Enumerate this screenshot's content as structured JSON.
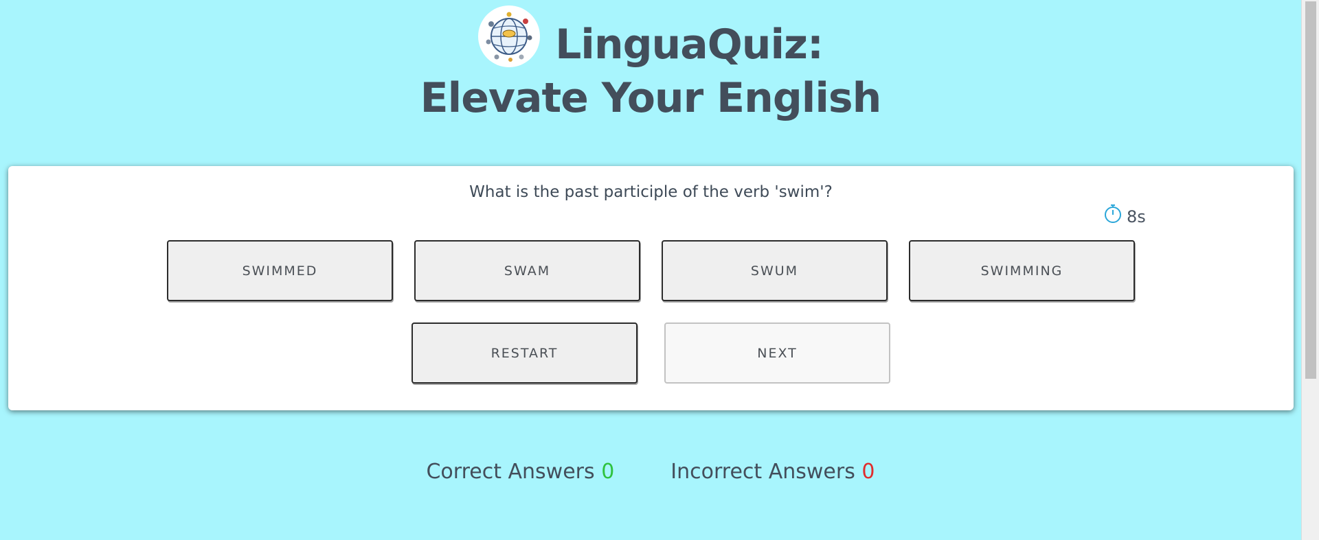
{
  "header": {
    "title_line1": "LinguaQuiz:",
    "title_line2": "Elevate Your English"
  },
  "quiz": {
    "question": "What is the past participle of the verb 'swim'?",
    "timer": "8s",
    "options": [
      "SWIMMED",
      "SWAM",
      "SWUM",
      "SWIMMING"
    ],
    "restart_label": "RESTART",
    "next_label": "NEXT"
  },
  "score": {
    "correct_label": "Correct Answers",
    "correct_value": "0",
    "incorrect_label": "Incorrect Answers",
    "incorrect_value": "0"
  },
  "colors": {
    "background": "#a8f5fd",
    "correct": "#2fc23f",
    "incorrect": "#e02d2d",
    "timer_icon": "#2aa6d9"
  },
  "icons": {
    "logo": "globe-icon",
    "timer": "stopwatch-icon"
  }
}
